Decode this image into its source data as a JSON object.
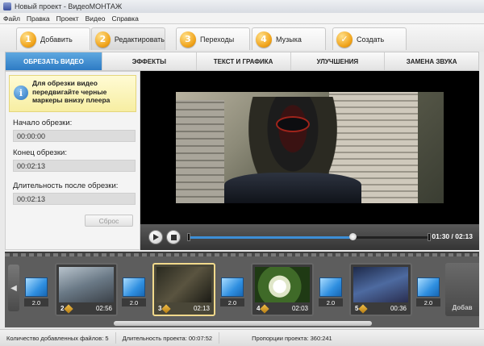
{
  "window": {
    "title": "Новый проект - ВидеоМОНТАЖ"
  },
  "menu": {
    "items": [
      "Файл",
      "Правка",
      "Проект",
      "Видео",
      "Справка"
    ]
  },
  "main_tabs": [
    {
      "num": "1",
      "label": "Добавить"
    },
    {
      "num": "2",
      "label": "Редактировать"
    },
    {
      "num": "3",
      "label": "Переходы"
    },
    {
      "num": "4",
      "label": "Музыка"
    },
    {
      "num": "✓",
      "label": "Создать"
    }
  ],
  "sub_tabs": [
    "ОБРЕЗАТЬ ВИДЕО",
    "ЭФФЕКТЫ",
    "ТЕКСТ И ГРАФИКА",
    "УЛУЧШЕНИЯ",
    "ЗАМЕНА ЗВУКА"
  ],
  "trim_panel": {
    "info": "Для обрезки видео передвигайте черные маркеры внизу плеера",
    "start_label": "Начало обрезки:",
    "start_value": "00:00:00",
    "end_label": "Конец обрезки:",
    "end_value": "00:02:13",
    "duration_label": "Длительность после обрезки:",
    "duration_value": "00:02:13",
    "reset_label": "Сброс"
  },
  "player": {
    "time_display": "01:30 / 02:13",
    "progress_fraction": 0.68
  },
  "storyboard": {
    "transitions": [
      "2.0",
      "2.0",
      "2.0",
      "2.0",
      "2.0"
    ],
    "clips": [
      {
        "num": "2",
        "duration": "02:56"
      },
      {
        "num": "3",
        "duration": "02:13"
      },
      {
        "num": "4",
        "duration": "02:03"
      },
      {
        "num": "5",
        "duration": "00:36"
      }
    ],
    "add_label": "Добав"
  },
  "status": {
    "files": "Количество добавленных файлов: 5",
    "duration": "Длительность проекта:  00:07:52",
    "ratio": "Пропорции проекта:  360:241"
  },
  "colors": {
    "accent": "#2d7bc4",
    "tab_badge": "#f0a31a",
    "selected_clip": "#f1d98c"
  }
}
